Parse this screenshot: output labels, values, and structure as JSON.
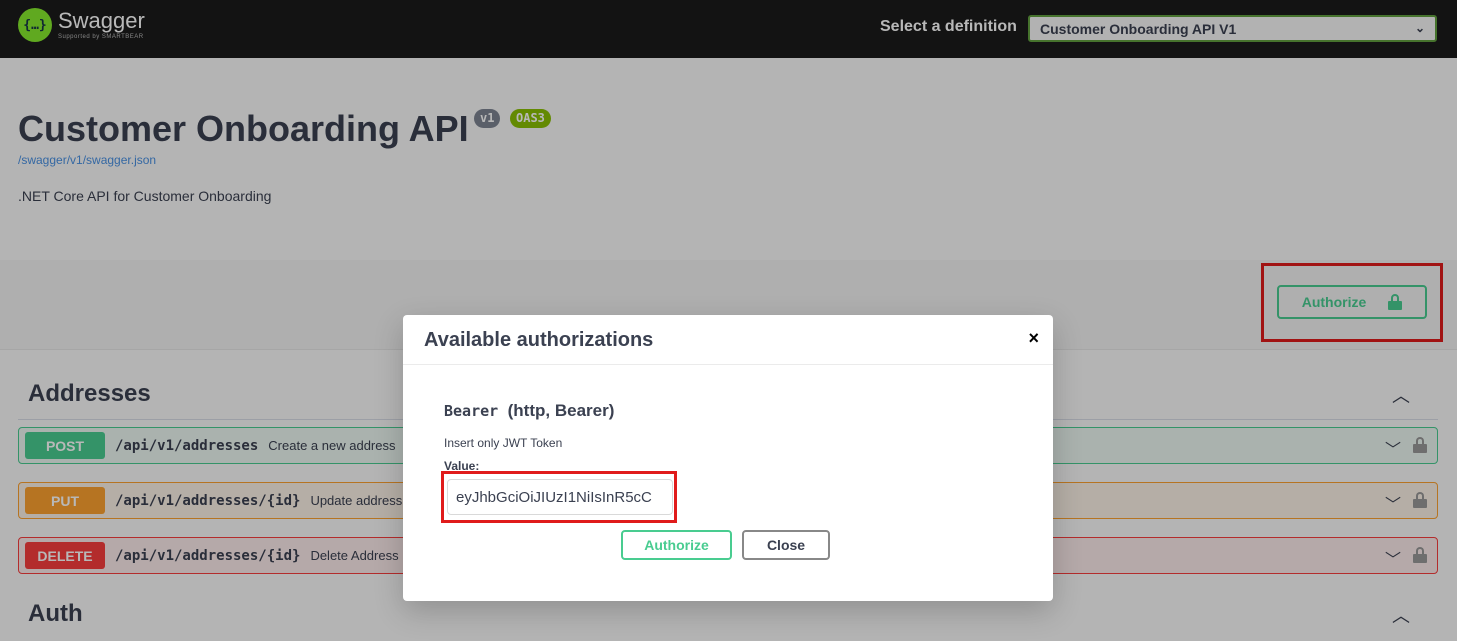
{
  "topbar": {
    "logo_name": "Swagger",
    "logo_sub": "Supported by SMARTBEAR",
    "select_label": "Select a definition",
    "selected_definition": "Customer Onboarding API V1"
  },
  "info": {
    "title": "Customer Onboarding API",
    "version": "v1",
    "oas": "OAS3",
    "url": "/swagger/v1/swagger.json",
    "description": ".NET Core API for Customer Onboarding"
  },
  "authorize_button": {
    "label": "Authorize"
  },
  "sections": [
    {
      "title": "Addresses",
      "operations": [
        {
          "method": "POST",
          "path": "/api/v1/addresses",
          "summary": "Create a new address"
        },
        {
          "method": "PUT",
          "path": "/api/v1/addresses/{id}",
          "summary": "Update address"
        },
        {
          "method": "DELETE",
          "path": "/api/v1/addresses/{id}",
          "summary": "Delete Address"
        }
      ]
    },
    {
      "title": "Auth"
    }
  ],
  "modal": {
    "title": "Available authorizations",
    "close_symbol": "×",
    "scheme_code": "Bearer",
    "scheme_type": "(http, Bearer)",
    "description": "Insert only JWT Token",
    "value_label": "Value:",
    "value": "eyJhbGciOiJIUzI1NiIsInR5cC",
    "authorize_label": "Authorize",
    "close_label": "Close"
  },
  "colors": {
    "post": "#49cc90",
    "put": "#fca130",
    "delete": "#f93e3e",
    "highlight": "#e01b1b"
  }
}
